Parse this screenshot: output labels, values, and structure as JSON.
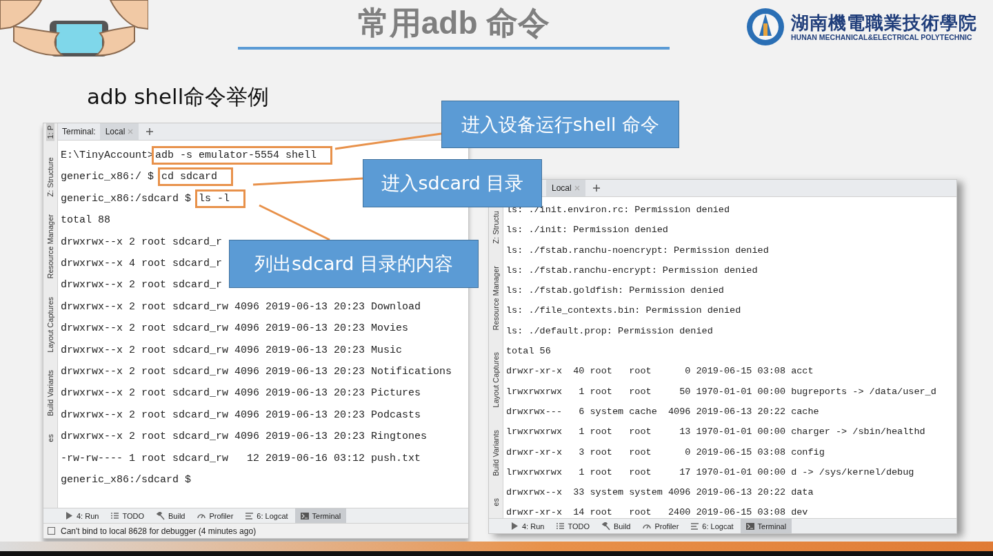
{
  "slide": {
    "title": "常用adb 命令",
    "subtitle": "adb shell命令举例"
  },
  "logo": {
    "name": "湖南機電職業技術學院",
    "english": "HUNAN MECHANICAL&ELECTRICAL POLYTECHNIC"
  },
  "windows": [
    {
      "side_tabs": [
        {
          "label": "1: P",
          "selected": true
        },
        {
          "label": "Z: Structure",
          "selected": false
        },
        {
          "label": "Resource Manager",
          "selected": false
        },
        {
          "label": "Layout Captures",
          "selected": false
        },
        {
          "label": "Build Variants",
          "selected": false
        },
        {
          "label": "es",
          "selected": false
        }
      ],
      "tab_caption": "Terminal:",
      "tabs": [
        {
          "label": "Local",
          "selected": true
        }
      ],
      "lines": [
        {
          "kind": "command",
          "prompt": "E:\\TinyAccount>",
          "command": "adb -s emulator-5554 shell",
          "highlighted": true
        },
        {
          "kind": "command",
          "prompt": "generic_x86:/ $ ",
          "command": "cd sdcard",
          "highlighted": true
        },
        {
          "kind": "command",
          "prompt": "generic_x86:/sdcard $ ",
          "command": "ls -l",
          "highlighted": true
        },
        {
          "kind": "output",
          "text": "total 88"
        },
        {
          "kind": "output",
          "text": "drwxrwx--x 2 root sdcard_r"
        },
        {
          "kind": "output",
          "text": "drwxrwx--x 4 root sdcard_r"
        },
        {
          "kind": "output",
          "text": "drwxrwx--x 2 root sdcard_r"
        },
        {
          "kind": "output",
          "text": "drwxrwx--x 2 root sdcard_rw 4096 2019-06-13 20:23 Download"
        },
        {
          "kind": "output",
          "text": "drwxrwx--x 2 root sdcard_rw 4096 2019-06-13 20:23 Movies"
        },
        {
          "kind": "output",
          "text": "drwxrwx--x 2 root sdcard_rw 4096 2019-06-13 20:23 Music"
        },
        {
          "kind": "output",
          "text": "drwxrwx--x 2 root sdcard_rw 4096 2019-06-13 20:23 Notifications"
        },
        {
          "kind": "output",
          "text": "drwxrwx--x 2 root sdcard_rw 4096 2019-06-13 20:23 Pictures"
        },
        {
          "kind": "output",
          "text": "drwxrwx--x 2 root sdcard_rw 4096 2019-06-13 20:23 Podcasts"
        },
        {
          "kind": "output",
          "text": "drwxrwx--x 2 root sdcard_rw 4096 2019-06-13 20:23 Ringtones"
        },
        {
          "kind": "output",
          "text": "-rw-rw---- 1 root sdcard_rw   12 2019-06-16 03:12 push.txt"
        },
        {
          "kind": "output",
          "text": "generic_x86:/sdcard $"
        }
      ],
      "bottom_tabs": [
        {
          "label": "4: Run",
          "selected": false
        },
        {
          "label": "TODO",
          "selected": false
        },
        {
          "label": "Build",
          "selected": false
        },
        {
          "label": "Profiler",
          "selected": false
        },
        {
          "label": "6: Logcat",
          "selected": false
        },
        {
          "label": "Terminal",
          "selected": true
        }
      ],
      "status": "Can't bind to local 8628 for debugger (4 minutes ago)"
    },
    {
      "side_tabs": [
        {
          "label": "Z: Structu",
          "selected": false
        },
        {
          "label": "Resource Manager",
          "selected": false
        },
        {
          "label": "Layout Captures",
          "selected": false
        },
        {
          "label": "Build Variants",
          "selected": false
        },
        {
          "label": "es",
          "selected": false
        }
      ],
      "tabs": [
        {
          "label": "Local",
          "selected": true
        }
      ],
      "lines": [
        {
          "kind": "output",
          "text": "ls: ./init.environ.rc: Permission denied"
        },
        {
          "kind": "output",
          "text": "ls: ./init: Permission denied"
        },
        {
          "kind": "output",
          "text": "ls: ./fstab.ranchu-noencrypt: Permission denied"
        },
        {
          "kind": "output",
          "text": "ls: ./fstab.ranchu-encrypt: Permission denied"
        },
        {
          "kind": "output",
          "text": "ls: ./fstab.goldfish: Permission denied"
        },
        {
          "kind": "output",
          "text": "ls: ./file_contexts.bin: Permission denied"
        },
        {
          "kind": "output",
          "text": "ls: ./default.prop: Permission denied"
        },
        {
          "kind": "output",
          "text": "total 56"
        },
        {
          "kind": "output",
          "text": "drwxr-xr-x  40 root   root      0 2019-06-15 03:08 acct"
        },
        {
          "kind": "output",
          "text": "lrwxrwxrwx   1 root   root     50 1970-01-01 00:00 bugreports -> /data/user_d"
        },
        {
          "kind": "output",
          "text": "drwxrwx---   6 system cache  4096 2019-06-13 20:22 cache"
        },
        {
          "kind": "output",
          "text": "lrwxrwxrwx   1 root   root     13 1970-01-01 00:00 charger -> /sbin/healthd"
        },
        {
          "kind": "output",
          "text": "drwxr-xr-x   3 root   root      0 2019-06-15 03:08 config"
        },
        {
          "kind": "output",
          "text": "lrwxrwxrwx   1 root   root     17 1970-01-01 00:00 d -> /sys/kernel/debug"
        },
        {
          "kind": "output",
          "text": "drwxrwx--x  33 system system 4096 2019-06-13 20:22 data"
        },
        {
          "kind": "output",
          "text": "drwxr-xr-x  14 root   root   2400 2019-06-15 03:08 dev"
        }
      ],
      "bottom_tabs": [
        {
          "label": "4: Run",
          "selected": false
        },
        {
          "label": "TODO",
          "selected": false
        },
        {
          "label": "Build",
          "selected": false
        },
        {
          "label": "Profiler",
          "selected": false
        },
        {
          "label": "6: Logcat",
          "selected": false
        },
        {
          "label": "Terminal",
          "selected": true
        }
      ]
    }
  ],
  "callouts": [
    {
      "text": "进入设备运行shell 命令"
    },
    {
      "text": "进入sdcard 目录"
    },
    {
      "text": "列出sdcard 目录的内容"
    }
  ]
}
